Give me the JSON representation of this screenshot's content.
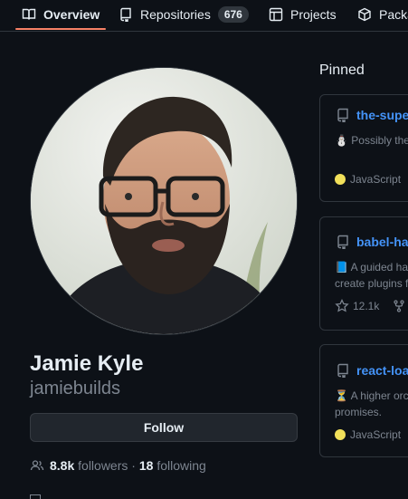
{
  "nav": {
    "tabs": [
      {
        "label": "Overview",
        "icon": "book-icon"
      },
      {
        "label": "Repositories",
        "icon": "repo-icon",
        "counter": "676"
      },
      {
        "label": "Projects",
        "icon": "project-table-icon"
      },
      {
        "label": "Packa",
        "icon": "package-icon"
      }
    ]
  },
  "profile": {
    "name": "Jamie Kyle",
    "login": "jamiebuilds",
    "follow_label": "Follow",
    "followers_count": "8.8k",
    "followers_label": "followers",
    "separator": "·",
    "following_count": "18",
    "following_label": "following"
  },
  "pinned": {
    "title": "Pinned",
    "repos": [
      {
        "name": "the-supe",
        "description": "⛄ Possibly the",
        "language": "JavaScript",
        "language_color": "#f1e05a"
      },
      {
        "name": "babel-ha",
        "description_line1": "📘 A guided ha",
        "description_line2": "create plugins f",
        "stars": "12.1k"
      },
      {
        "name": "react-loac",
        "description_line1": "⏳ A higher orc",
        "description_line2": "promises.",
        "language": "JavaScript",
        "language_color": "#f1e05a"
      }
    ]
  },
  "colors": {
    "background": "#0d1117",
    "accent_underline": "#f78166",
    "link": "#4493f8"
  }
}
